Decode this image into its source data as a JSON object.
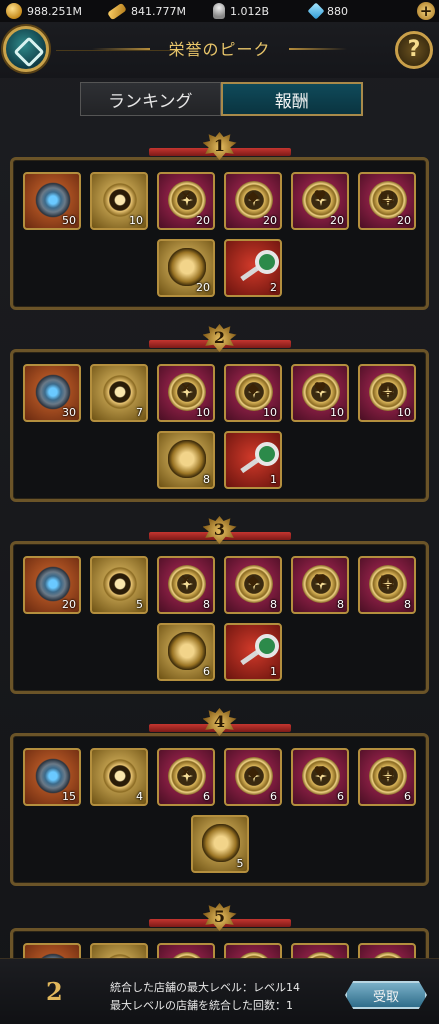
{
  "currencies": [
    {
      "name": "gold",
      "icon": "coin-icon",
      "value": "988.251M"
    },
    {
      "name": "cash",
      "icon": "banknote-icon",
      "value": "841.777M"
    },
    {
      "name": "helmet",
      "icon": "helmet-icon",
      "value": "1.012B"
    },
    {
      "name": "diamond",
      "icon": "diamond-icon",
      "value": "880"
    }
  ],
  "header": {
    "title": "栄誉のピーク"
  },
  "tabs": [
    {
      "label": "ランキング",
      "active": false
    },
    {
      "label": "報酬",
      "active": true
    }
  ],
  "sections": [
    {
      "rank": "1",
      "rows": [
        [
          {
            "type": "orange",
            "icon": "shield-icon",
            "qty": "50"
          },
          {
            "type": "gold",
            "icon": "compass-icon",
            "qty": "10"
          },
          {
            "type": "purple",
            "icon": "swords-medal-icon",
            "qty": "20"
          },
          {
            "type": "purple",
            "icon": "handshake-medal-icon",
            "qty": "20"
          },
          {
            "type": "purple",
            "icon": "heart-medal-icon",
            "qty": "20"
          },
          {
            "type": "purple",
            "icon": "book-medal-icon",
            "qty": "20"
          }
        ],
        [
          {
            "type": "gold",
            "icon": "crest-icon",
            "qty": "20"
          },
          {
            "type": "red",
            "icon": "key-icon",
            "qty": "2"
          }
        ]
      ]
    },
    {
      "rank": "2",
      "rows": [
        [
          {
            "type": "orange",
            "icon": "shield-icon",
            "qty": "30"
          },
          {
            "type": "gold",
            "icon": "compass-icon",
            "qty": "7"
          },
          {
            "type": "purple",
            "icon": "swords-medal-icon",
            "qty": "10"
          },
          {
            "type": "purple",
            "icon": "handshake-medal-icon",
            "qty": "10"
          },
          {
            "type": "purple",
            "icon": "heart-medal-icon",
            "qty": "10"
          },
          {
            "type": "purple",
            "icon": "book-medal-icon",
            "qty": "10"
          }
        ],
        [
          {
            "type": "gold",
            "icon": "crest-icon",
            "qty": "8"
          },
          {
            "type": "red",
            "icon": "key-icon",
            "qty": "1"
          }
        ]
      ]
    },
    {
      "rank": "3",
      "rows": [
        [
          {
            "type": "orange",
            "icon": "shield-icon",
            "qty": "20"
          },
          {
            "type": "gold",
            "icon": "compass-icon",
            "qty": "5"
          },
          {
            "type": "purple",
            "icon": "swords-medal-icon",
            "qty": "8"
          },
          {
            "type": "purple",
            "icon": "handshake-medal-icon",
            "qty": "8"
          },
          {
            "type": "purple",
            "icon": "heart-medal-icon",
            "qty": "8"
          },
          {
            "type": "purple",
            "icon": "book-medal-icon",
            "qty": "8"
          }
        ],
        [
          {
            "type": "gold",
            "icon": "crest-icon",
            "qty": "6"
          },
          {
            "type": "red",
            "icon": "key-icon",
            "qty": "1"
          }
        ]
      ]
    },
    {
      "rank": "4",
      "rows": [
        [
          {
            "type": "orange",
            "icon": "shield-icon",
            "qty": "15"
          },
          {
            "type": "gold",
            "icon": "compass-icon",
            "qty": "4"
          },
          {
            "type": "purple",
            "icon": "swords-medal-icon",
            "qty": "6"
          },
          {
            "type": "purple",
            "icon": "handshake-medal-icon",
            "qty": "6"
          },
          {
            "type": "purple",
            "icon": "heart-medal-icon",
            "qty": "6"
          },
          {
            "type": "purple",
            "icon": "book-medal-icon",
            "qty": "6"
          }
        ],
        [
          {
            "type": "gold",
            "icon": "crest-icon",
            "qty": "5"
          }
        ]
      ]
    },
    {
      "rank": "5",
      "rows": [
        [
          {
            "type": "orange",
            "icon": "shield-icon",
            "qty": ""
          },
          {
            "type": "gold",
            "icon": "compass-icon",
            "qty": ""
          },
          {
            "type": "purple",
            "icon": "swords-medal-icon",
            "qty": ""
          },
          {
            "type": "purple",
            "icon": "handshake-medal-icon",
            "qty": ""
          },
          {
            "type": "purple",
            "icon": "heart-medal-icon",
            "qty": ""
          },
          {
            "type": "purple",
            "icon": "book-medal-icon",
            "qty": ""
          }
        ]
      ]
    }
  ],
  "footer": {
    "my_rank": "2",
    "info_line1": "統合した店舗の最大レベル：レベル14",
    "info_line2": "最大レベルの店舗を統合した回数：1",
    "claim_label": "受取"
  }
}
